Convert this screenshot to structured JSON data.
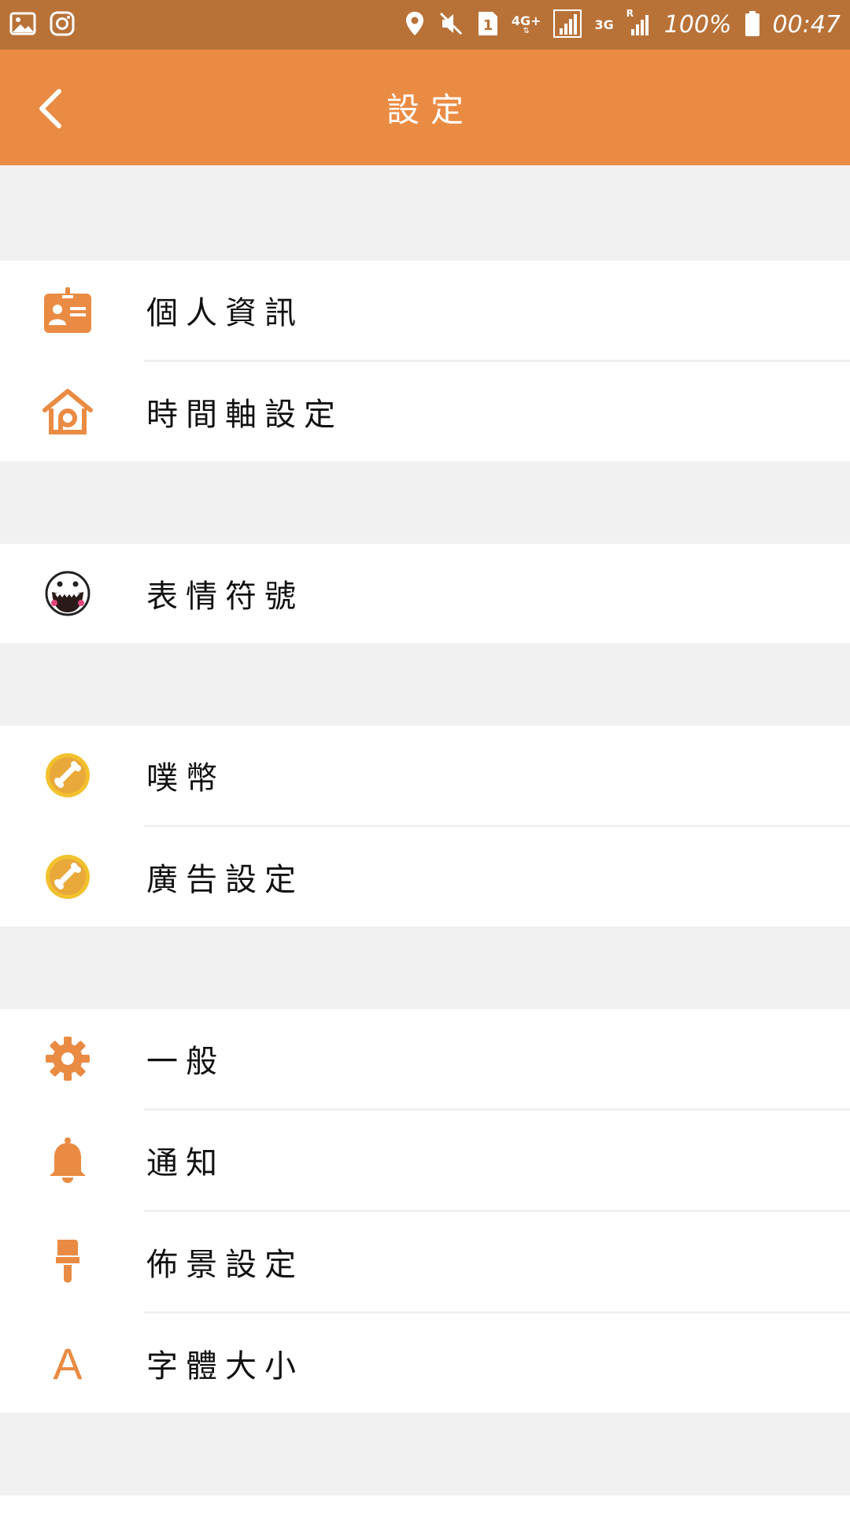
{
  "status_bar": {
    "battery": "100%",
    "time": "00:47",
    "network_4g": "4G+",
    "network_3g": "3G",
    "roaming": "R",
    "sim": "1"
  },
  "header": {
    "title": "設定"
  },
  "colors": {
    "status_bar": "#b87238",
    "app_bar": "#ea8b43",
    "accent": "#ea8b43",
    "background": "#f1f1f1"
  },
  "groups": [
    {
      "items": [
        {
          "label": "個人資訊",
          "icon": "id-card-icon"
        },
        {
          "label": "時間軸設定",
          "icon": "home-icon"
        }
      ]
    },
    {
      "items": [
        {
          "label": "表情符號",
          "icon": "emoji-icon"
        }
      ]
    },
    {
      "items": [
        {
          "label": "噗幣",
          "icon": "coin-icon"
        },
        {
          "label": "廣告設定",
          "icon": "coin-icon"
        }
      ]
    },
    {
      "items": [
        {
          "label": "一般",
          "icon": "gear-icon"
        },
        {
          "label": "通知",
          "icon": "bell-icon"
        },
        {
          "label": "佈景設定",
          "icon": "brush-icon"
        },
        {
          "label": "字體大小",
          "icon": "font-size-icon",
          "glyph": "A"
        }
      ]
    }
  ]
}
